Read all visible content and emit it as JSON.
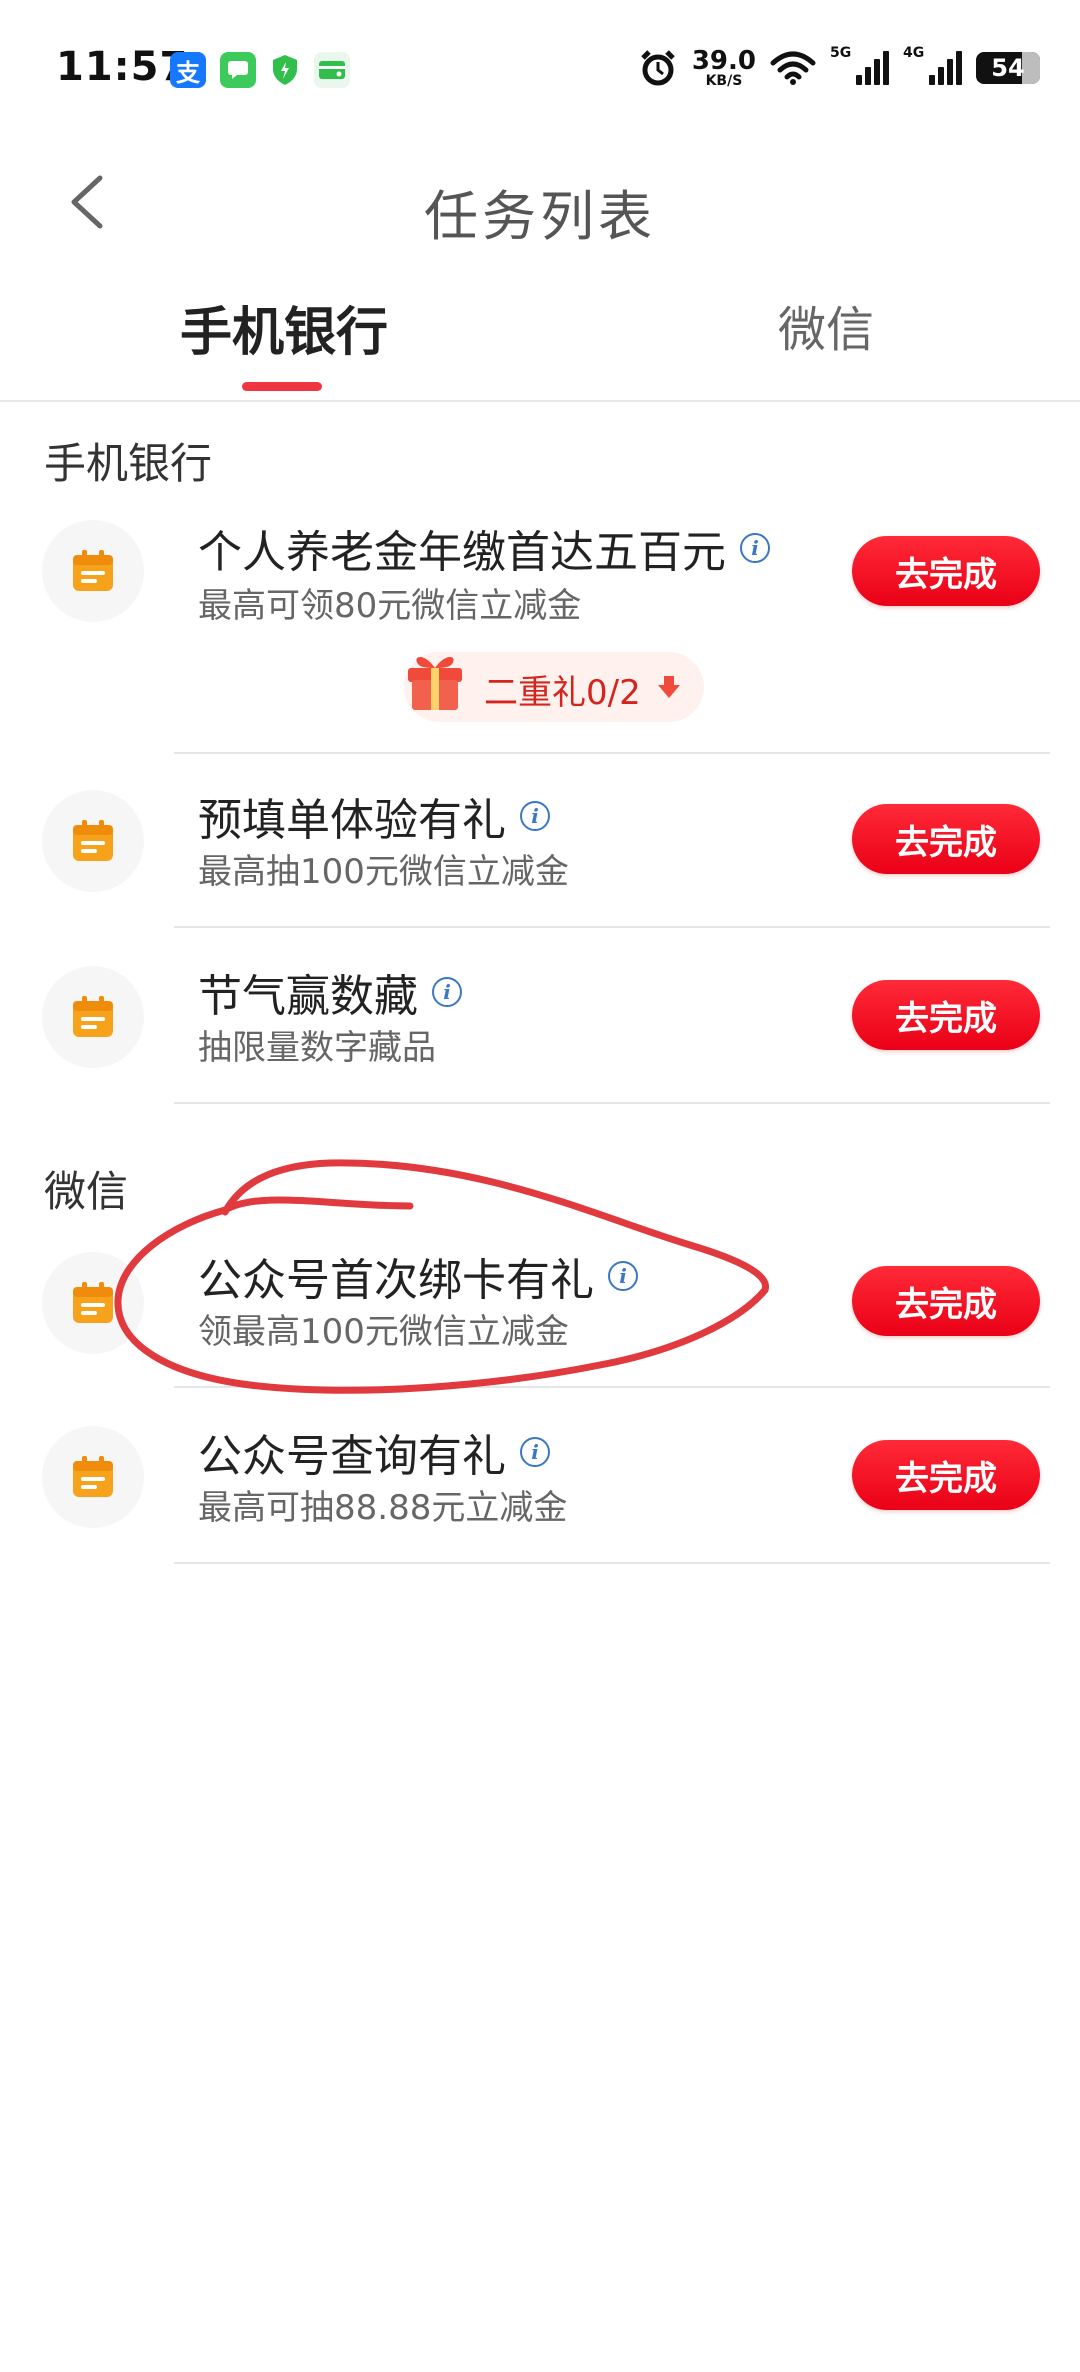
{
  "status_bar": {
    "time": "11:57",
    "net_speed_value": "39.0",
    "net_speed_unit": "KB/S",
    "signal_1_label": "5G",
    "signal_2_label": "4G",
    "battery": "54",
    "app_icons": [
      "alipay-icon",
      "message-icon",
      "shield-icon",
      "wallet-icon"
    ]
  },
  "header": {
    "title": "任务列表"
  },
  "tabs": [
    {
      "label": "手机银行",
      "active": true
    },
    {
      "label": "微信",
      "active": false
    }
  ],
  "sections": [
    {
      "title": "手机银行",
      "tasks": [
        {
          "title": "个人养老金年缴首达五百元",
          "subtitle": "最高可领80元微信立减金",
          "button": "去完成"
        },
        {
          "title": "预填单体验有礼",
          "subtitle": "最高抽100元微信立减金",
          "button": "去完成"
        },
        {
          "title": "节气赢数藏",
          "subtitle": "抽限量数字藏品",
          "button": "去完成"
        }
      ]
    },
    {
      "title": "微信",
      "tasks": [
        {
          "title": "公众号首次绑卡有礼",
          "subtitle": "领最高100元微信立减金",
          "button": "去完成"
        },
        {
          "title": "公众号查询有礼",
          "subtitle": "最高可抽88.88元立减金",
          "button": "去完成"
        }
      ]
    }
  ],
  "gift_badge": {
    "label": "二重礼0/2"
  },
  "colors": {
    "accent_red": "#ee3640",
    "task_icon_orange": "#f7a21b",
    "info_blue": "#3a78c4",
    "annotation_red": "#e03a3e"
  }
}
